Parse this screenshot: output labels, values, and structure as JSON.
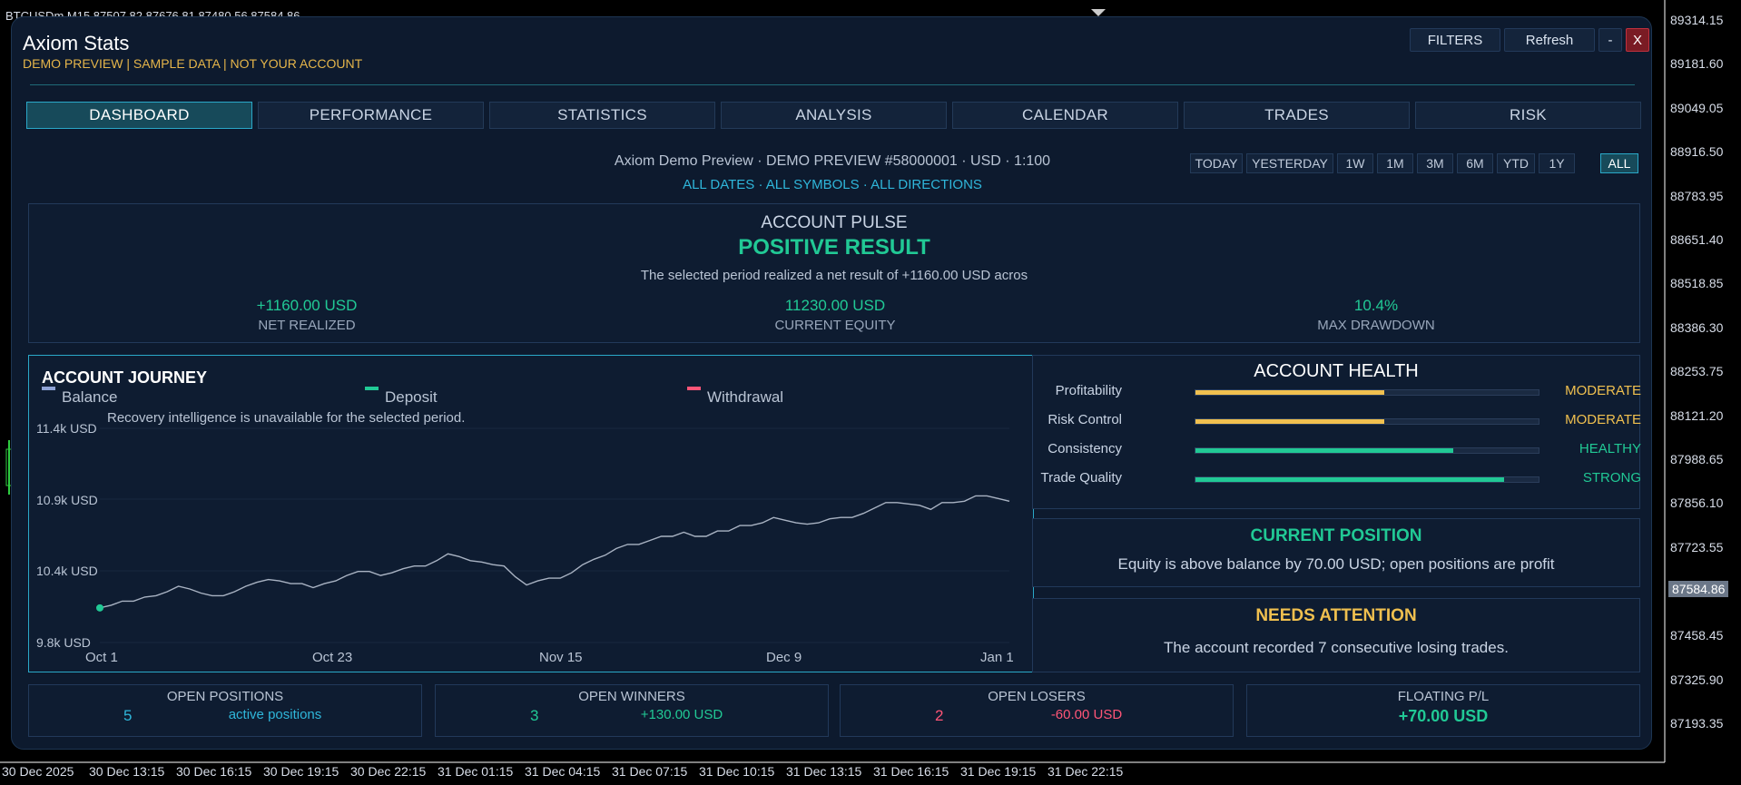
{
  "terminal": {
    "symbol_header": "BTCUSDm,M15  87507.82 87676.81 87480.56 87584.86",
    "price_ticks": [
      "89314.15",
      "89181.60",
      "89049.05",
      "88916.50",
      "88783.95",
      "88651.40",
      "88518.85",
      "88386.30",
      "88253.75",
      "88121.20",
      "87988.65",
      "87856.10",
      "87723.55",
      "87458.45",
      "87325.90",
      "87193.35"
    ],
    "current_price": "87584.86",
    "time_ticks": [
      "30 Dec 2025",
      "30 Dec 13:15",
      "30 Dec 16:15",
      "30 Dec 19:15",
      "30 Dec 22:15",
      "31 Dec 01:15",
      "31 Dec 04:15",
      "31 Dec 07:15",
      "31 Dec 10:15",
      "31 Dec 13:15",
      "31 Dec 16:15",
      "31 Dec 19:15",
      "31 Dec 22:15"
    ]
  },
  "app": {
    "title": "Axiom Stats",
    "subtitle": "DEMO PREVIEW | SAMPLE DATA | NOT YOUR ACCOUNT",
    "buttons": {
      "filters": "FILTERS",
      "refresh": "Refresh",
      "minimize": "-",
      "close": "X"
    }
  },
  "tabs": [
    "DASHBOARD",
    "PERFORMANCE",
    "STATISTICS",
    "ANALYSIS",
    "CALENDAR",
    "TRADES",
    "RISK"
  ],
  "active_tab": "DASHBOARD",
  "account_line": "Axiom Demo Preview  ·  DEMO PREVIEW #58000001  ·  USD  ·  1:100",
  "filter_line": "ALL DATES · ALL SYMBOLS · ALL DIRECTIONS",
  "ranges": [
    "TODAY",
    "YESTERDAY",
    "1W",
    "1M",
    "3M",
    "6M",
    "YTD",
    "1Y",
    "ALL"
  ],
  "active_range": "ALL",
  "pulse": {
    "title": "ACCOUNT PULSE",
    "result": "POSITIVE RESULT",
    "description": "The selected period realized a net result of +1160.00 USD acros",
    "kpis": [
      {
        "value": "+1160.00 USD",
        "label": "NET REALIZED"
      },
      {
        "value": "11230.00 USD",
        "label": "CURRENT EQUITY"
      },
      {
        "value": "10.4%",
        "label": "MAX DRAWDOWN"
      }
    ]
  },
  "journey": {
    "title": "ACCOUNT JOURNEY",
    "legend": [
      {
        "name": "Balance",
        "color": "#8fa3d6"
      },
      {
        "name": "Deposit",
        "color": "#21c995"
      },
      {
        "name": "Withdrawal",
        "color": "#ff5577"
      }
    ],
    "note": "Recovery intelligence is unavailable for the selected period."
  },
  "chart_data": {
    "type": "line",
    "title": "ACCOUNT JOURNEY",
    "y_ticks": [
      "11.4k USD",
      "10.9k USD",
      "10.4k USD",
      "9.8k USD"
    ],
    "x_ticks": [
      "Oct 1",
      "Oct 23",
      "Nov 15",
      "Dec 9",
      "Jan 1"
    ],
    "ylim": [
      9800,
      11400
    ],
    "series": [
      {
        "name": "Balance",
        "values": [
          10070,
          10090,
          10120,
          10120,
          10150,
          10160,
          10190,
          10230,
          10210,
          10180,
          10160,
          10160,
          10190,
          10230,
          10260,
          10280,
          10270,
          10250,
          10250,
          10220,
          10250,
          10270,
          10310,
          10340,
          10340,
          10310,
          10330,
          10360,
          10380,
          10380,
          10420,
          10470,
          10450,
          10420,
          10410,
          10390,
          10380,
          10300,
          10240,
          10270,
          10290,
          10290,
          10330,
          10390,
          10430,
          10460,
          10510,
          10540,
          10540,
          10570,
          10600,
          10600,
          10630,
          10600,
          10600,
          10640,
          10640,
          10680,
          10680,
          10700,
          10740,
          10720,
          10700,
          10690,
          10700,
          10730,
          10740,
          10740,
          10770,
          10810,
          10850,
          10850,
          10840,
          10830,
          10800,
          10850,
          10850,
          10860,
          10900,
          10900,
          10880,
          10860
        ],
        "color": "#a9b3c3"
      }
    ],
    "start_marker_value": 10070
  },
  "health": {
    "title": "ACCOUNT HEALTH",
    "rows": [
      {
        "label": "Profitability",
        "status": "MODERATE",
        "level": 0.55,
        "color": "#f0c04f"
      },
      {
        "label": "Risk Control",
        "status": "MODERATE",
        "level": 0.55,
        "color": "#f0c04f"
      },
      {
        "label": "Consistency",
        "status": "HEALTHY",
        "level": 0.75,
        "color": "#21c995"
      },
      {
        "label": "Trade Quality",
        "status": "STRONG",
        "level": 0.9,
        "color": "#21c995"
      }
    ]
  },
  "current_position": {
    "title": "CURRENT POSITION",
    "text": "Equity is above balance by 70.00 USD; open positions are profit"
  },
  "needs_attention": {
    "title": "NEEDS ATTENTION",
    "text": "The account recorded 7 consecutive losing trades."
  },
  "stats": {
    "open_positions": {
      "title": "OPEN POSITIONS",
      "count": "5",
      "detail": "active positions"
    },
    "open_winners": {
      "title": "OPEN WINNERS",
      "count": "3",
      "detail": "+130.00 USD"
    },
    "open_losers": {
      "title": "OPEN LOSERS",
      "count": "2",
      "detail": "-60.00 USD"
    },
    "floating": {
      "title": "FLOATING P/L",
      "value": "+70.00 USD"
    }
  }
}
